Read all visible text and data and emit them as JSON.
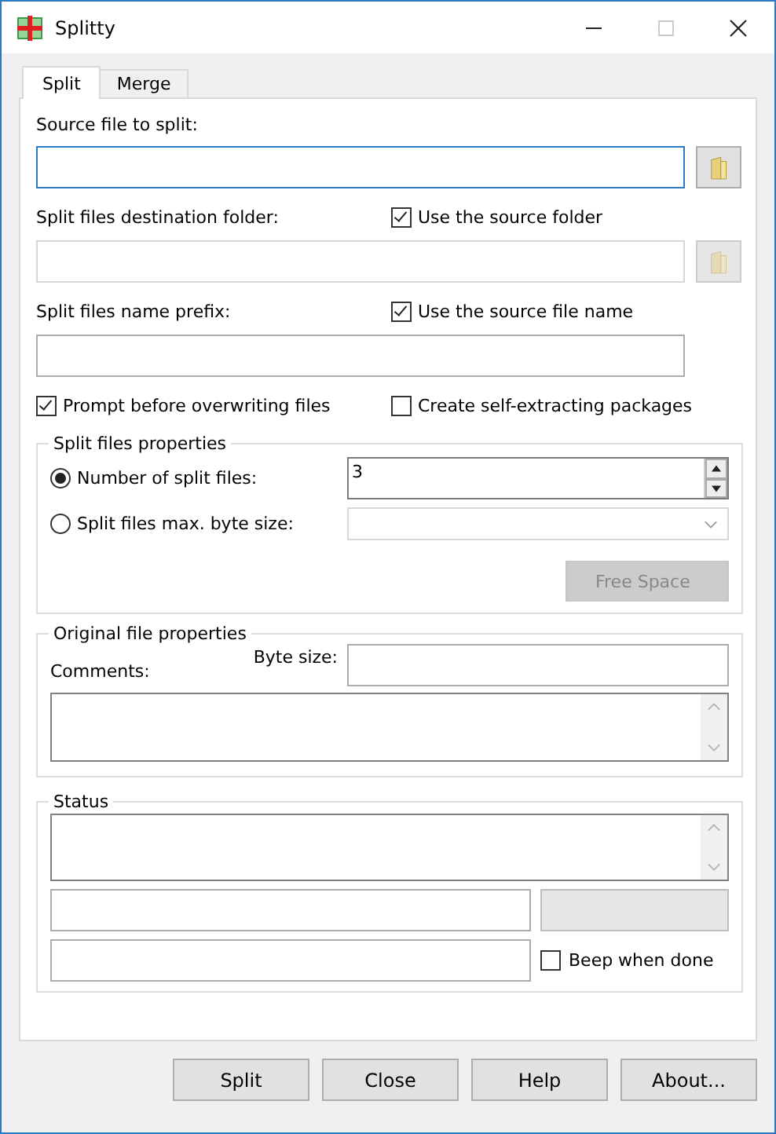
{
  "window": {
    "title": "Splitty"
  },
  "tabs": [
    {
      "label": "Split",
      "selected": true
    },
    {
      "label": "Merge",
      "selected": false
    }
  ],
  "source": {
    "label": "Source file to split:"
  },
  "destination": {
    "label": "Split files destination folder:",
    "disabled": true,
    "option": {
      "label": "Use the source folder",
      "checked": true
    }
  },
  "prefix": {
    "label": "Split files name prefix:",
    "option": {
      "label": "Use the source file name",
      "checked": true
    }
  },
  "options": [
    {
      "label": "Prompt before overwriting files",
      "checked": true
    },
    {
      "label": "Create self-extracting packages",
      "checked": false
    }
  ],
  "split_properties": {
    "title": "Split files properties",
    "modes": [
      {
        "label": "Number of split files:",
        "selected": true
      },
      {
        "label": "Split files max. byte size:",
        "selected": false
      }
    ],
    "count": "3",
    "free_space_button": {
      "label": "Free Space",
      "disabled": true
    }
  },
  "original": {
    "title": "Original file properties",
    "comments_label": "Comments:",
    "byte_size_label": "Byte size:"
  },
  "status": {
    "title": "Status",
    "progress": {
      "level": 0
    },
    "beep": {
      "label": "Beep when done",
      "checked": false
    }
  },
  "buttons": [
    "Split",
    "Close",
    "Help",
    "About..."
  ]
}
